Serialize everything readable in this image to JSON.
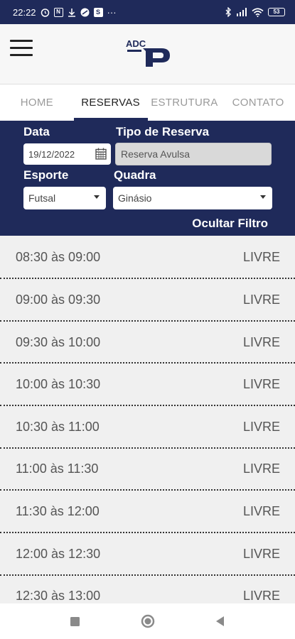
{
  "status_bar": {
    "time": "22:22",
    "battery": "53",
    "more": "···"
  },
  "app": {
    "logo_text": "ADC"
  },
  "tabs": [
    {
      "label": "HOME",
      "active": false
    },
    {
      "label": "RESERVAS",
      "active": true
    },
    {
      "label": "ESTRUTURA",
      "active": false
    },
    {
      "label": "CONTATO",
      "active": false
    }
  ],
  "filter": {
    "date_label": "Data",
    "date_value": "19/12/2022",
    "type_label": "Tipo de Reserva",
    "type_value": "Reserva Avulsa",
    "sport_label": "Esporte",
    "sport_value": "Futsal",
    "court_label": "Quadra",
    "court_value": "Ginásio",
    "hide_label": "Ocultar Filtro"
  },
  "slots": [
    {
      "time": "08:30 às 09:00",
      "status": "LIVRE"
    },
    {
      "time": "09:00 às 09:30",
      "status": "LIVRE"
    },
    {
      "time": "09:30 às 10:00",
      "status": "LIVRE"
    },
    {
      "time": "10:00 às 10:30",
      "status": "LIVRE"
    },
    {
      "time": "10:30 às 11:00",
      "status": "LIVRE"
    },
    {
      "time": "11:00 às 11:30",
      "status": "LIVRE"
    },
    {
      "time": "11:30 às 12:00",
      "status": "LIVRE"
    },
    {
      "time": "12:00 às 12:30",
      "status": "LIVRE"
    },
    {
      "time": "12:30 às 13:00",
      "status": "LIVRE"
    }
  ],
  "colors": {
    "brand": "#1f2a5a",
    "background": "#f0f0f0"
  },
  "icons": {
    "menu": "hamburger-menu-icon",
    "calendar": "calendar-icon",
    "nav_recents": "square-icon",
    "nav_home": "circle-icon",
    "nav_back": "triangle-back-icon"
  }
}
